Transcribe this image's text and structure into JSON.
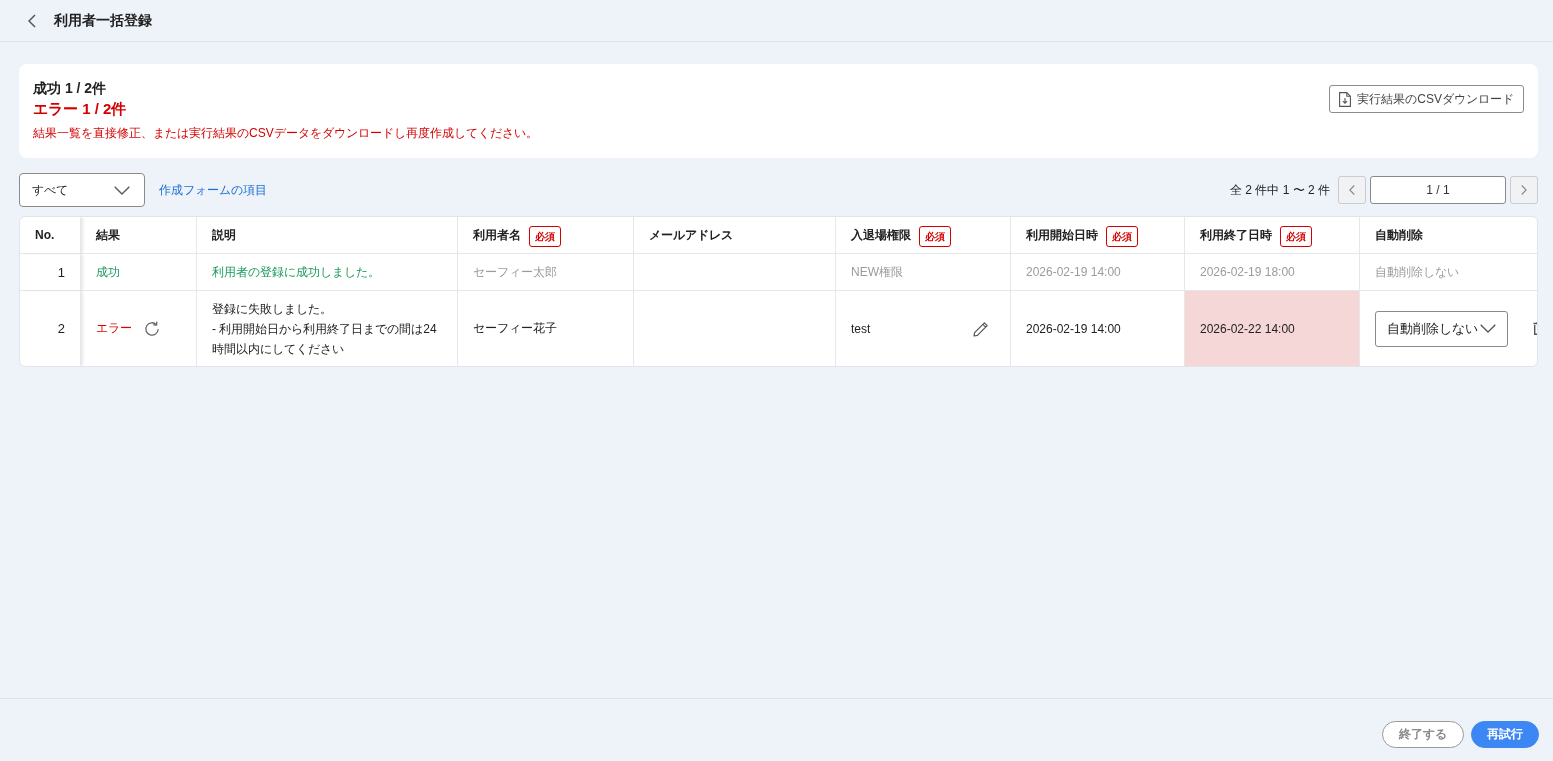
{
  "header": {
    "title": "利用者一括登録"
  },
  "summary": {
    "success": "成功 1 / 2件",
    "error": "エラー 1 / 2件",
    "message": "結果一覧を直接修正、または実行結果のCSVデータをダウンロードし再度作成してください。",
    "download_button": "実行結果のCSVダウンロード"
  },
  "toolbar": {
    "filter": {
      "value": "すべて"
    },
    "link": "作成フォームの項目",
    "pagination": {
      "count": "全 2 件中 1 〜 2 件",
      "page": "1 / 1",
      "prev": {
        "disabled": true
      },
      "next": {
        "disabled": true
      }
    }
  },
  "table": {
    "columns": [
      {
        "label": "No."
      },
      {
        "label": "結果"
      },
      {
        "label": "説明"
      },
      {
        "label": "利用者名",
        "badge": "必須"
      },
      {
        "label": "メールアドレス"
      },
      {
        "label": "入退場権限",
        "badge": "必須"
      },
      {
        "label": "利用開始日時",
        "badge": "必須"
      },
      {
        "label": "利用終了日時",
        "badge": "必須"
      },
      {
        "label": "自動削除"
      }
    ],
    "rows": [
      {
        "disabled": true,
        "cells": [
          {
            "kind": "number",
            "text": "1"
          },
          {
            "kind": "success",
            "text": "成功"
          },
          {
            "kind": "description",
            "lines": [
              "利用者の登録に成功しました。"
            ]
          },
          {
            "kind": "text",
            "text": "セーフィー太郎",
            "editable": false,
            "invalid": false
          },
          {
            "kind": "empty"
          },
          {
            "kind": "text",
            "text": "NEW権限",
            "editable": false,
            "invalid": false
          },
          {
            "kind": "text",
            "text": "2026-02-19 14:00",
            "editable": false,
            "invalid": false
          },
          {
            "kind": "text",
            "text": "2026-02-19 18:00",
            "editable": false,
            "invalid": false
          },
          {
            "kind": "text",
            "text": "自動削除しない",
            "editable": false,
            "invalid": false
          }
        ]
      },
      {
        "disabled": false,
        "cells": [
          {
            "kind": "number",
            "text": "2"
          },
          {
            "kind": "error",
            "text": "エラー"
          },
          {
            "kind": "description",
            "lines": [
              "登録に失敗しました。",
              "- 利用開始日から利用終了日までの間は24時間以内にしてください"
            ]
          },
          {
            "kind": "text",
            "text": "セーフィー花子",
            "editable": false,
            "invalid": false
          },
          {
            "kind": "empty"
          },
          {
            "kind": "text",
            "text": "test",
            "editable": true,
            "invalid": false
          },
          {
            "kind": "text",
            "text": "2026-02-19 14:00",
            "editable": false,
            "invalid": false
          },
          {
            "kind": "text",
            "text": "2026-02-22 14:00",
            "editable": false,
            "invalid": true
          },
          {
            "kind": "select",
            "text": "自動削除しない",
            "deletable": true
          }
        ]
      }
    ]
  },
  "footer": {
    "buttons": [
      {
        "kind": "secondary",
        "label": "終了する"
      },
      {
        "kind": "primary",
        "label": "再試行"
      }
    ]
  }
}
